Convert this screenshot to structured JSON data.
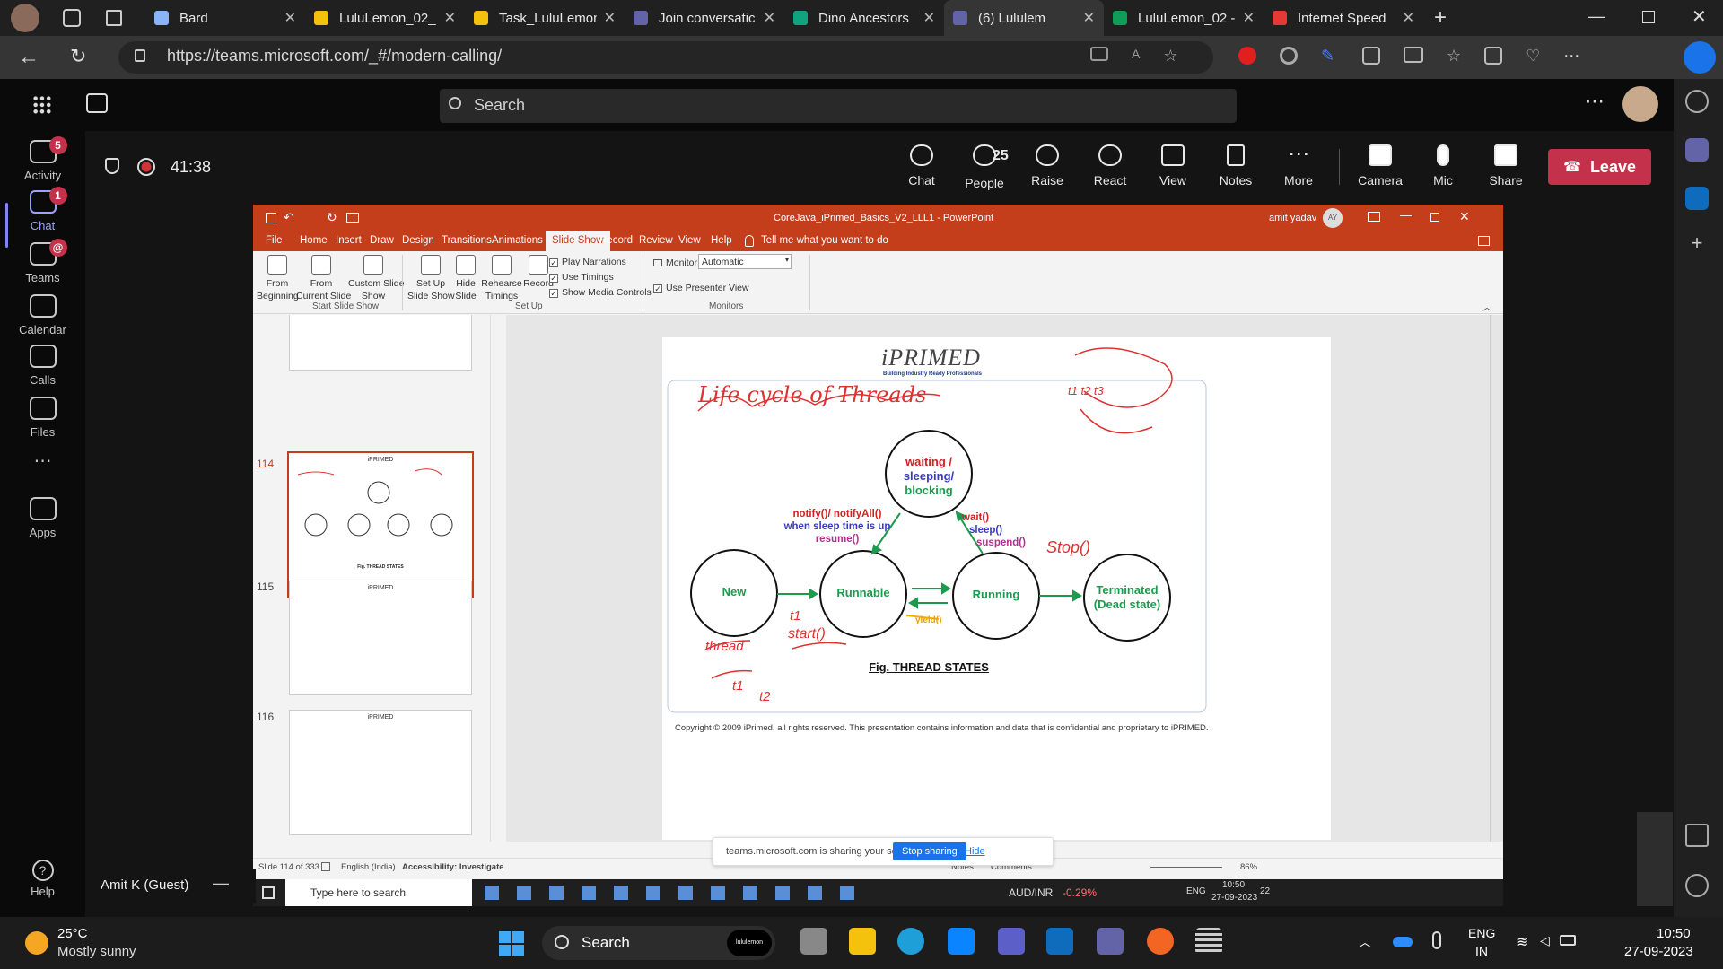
{
  "browser": {
    "tabs": [
      {
        "label": "Bard",
        "color": "#8ab4f8"
      },
      {
        "label": "LuluLemon_02_",
        "color": "#f4c20d"
      },
      {
        "label": "Task_LuluLemon",
        "color": "#f4c20d"
      },
      {
        "label": "Join conversatic",
        "color": "#6264a7"
      },
      {
        "label": "Dino Ancestors",
        "color": "#10a37f"
      },
      {
        "label": "(6) Lululem",
        "color": "#6264a7"
      },
      {
        "label": "LuluLemon_02 -",
        "color": "#0f9d58"
      },
      {
        "label": "Internet Speed",
        "color": "#e53935"
      }
    ],
    "url": "https://teams.microsoft.com/_#/modern-calling/"
  },
  "teams": {
    "search_placeholder": "Search",
    "rail": [
      {
        "label": "Activity",
        "badge": "5"
      },
      {
        "label": "Chat",
        "badge": "1"
      },
      {
        "label": "Teams",
        "badge": "@"
      },
      {
        "label": "Calendar",
        "badge": ""
      },
      {
        "label": "Calls",
        "badge": ""
      },
      {
        "label": "Files",
        "badge": ""
      },
      {
        "label": "...",
        "badge": ""
      },
      {
        "label": "Apps",
        "badge": ""
      }
    ],
    "help_label": "Help",
    "timer": "41:38",
    "controls": {
      "chat": "Chat",
      "people": "People",
      "people_count": "25",
      "raise": "Raise",
      "react": "React",
      "view": "View",
      "notes": "Notes",
      "more": "More",
      "camera": "Camera",
      "mic": "Mic",
      "share": "Share",
      "leave": "Leave"
    },
    "participant_name": "Amit K (Guest)"
  },
  "ppt": {
    "title": "CoreJava_iPrimed_Basics_V2_LLL1  -  PowerPoint",
    "user": "amit yadav",
    "user_initials": "AY",
    "tabs": [
      "File",
      "Home",
      "Insert",
      "Draw",
      "Design",
      "Transitions",
      "Animations",
      "Slide Show",
      "Record",
      "Review",
      "View",
      "Help"
    ],
    "tell_me": "Tell me what you want to do",
    "ribbon": {
      "from_beginning": "From\nBeginning",
      "from_current": "From\nCurrent Slide",
      "custom_show": "Custom Slide\nShow",
      "group_start": "Start Slide Show",
      "setup_show": "Set Up\nSlide Show",
      "hide_slide": "Hide\nSlide",
      "rehearse": "Rehearse\nTimings",
      "record": "Record",
      "play_narrations": "Play Narrations",
      "use_timings": "Use Timings",
      "show_media": "Show Media Controls",
      "group_setup": "Set Up",
      "monitor_label": "Monitor:",
      "monitor_value": "Automatic",
      "presenter_view": "Use Presenter View",
      "group_monitors": "Monitors"
    },
    "thumb_numbers": [
      "114",
      "115",
      "116"
    ],
    "thumb_logo": "iPRIMED",
    "thumb_caption": "Fig. THREAD STATES",
    "slide": {
      "logo": "iPRIMED",
      "tagline": "Building Industry Ready Professionals",
      "states": {
        "waiting": [
          "waiting /",
          "sleeping/",
          "blocking"
        ],
        "new": "New",
        "runnable": "Runnable",
        "running": "Running",
        "terminated": [
          "Terminated",
          "(Dead state)"
        ]
      },
      "notify": [
        "notify()/ notifyAll()",
        "when sleep time is up",
        "resume()"
      ],
      "wait": [
        "wait()",
        "sleep()",
        "suspend()"
      ],
      "yield": "yield()",
      "caption": "Fig. THREAD STATES",
      "copyright": "Copyright © 2009 iPrimed, all rights reserved. This presentation contains information  and data  that is confidential and proprietary to iPRIMED.",
      "handwriting": {
        "title": "Life cycle of Threads",
        "start": "start()",
        "stop": "Stop()",
        "thread": "thread",
        "t1": "t1",
        "t1b": "t1",
        "t2": "t2",
        "t1t2t3": "t1  t2  t3"
      }
    },
    "status": {
      "slide": "Slide 114 of 333",
      "lang": "English (India)",
      "access": "Accessibility: Investigate",
      "notes": "Notes",
      "comments": "Comments",
      "zoom": "86%"
    },
    "sharebar": {
      "text": "teams.microsoft.com is sharing your screen.",
      "stop": "Stop sharing",
      "hide": "Hide"
    },
    "remote_taskbar": {
      "search": "Type here to search",
      "ticker": "AUD/INR",
      "ticker_change": "-0.29%",
      "lang": "ENG",
      "time": "10:50",
      "date": "27-09-2023",
      "notif": "22"
    }
  },
  "taskbar": {
    "weather_temp": "25°C",
    "weather_desc": "Mostly sunny",
    "search": "Search",
    "lang1": "ENG",
    "lang2": "IN",
    "time": "10:50",
    "date": "27-09-2023",
    "search_badge": "lululemon"
  }
}
